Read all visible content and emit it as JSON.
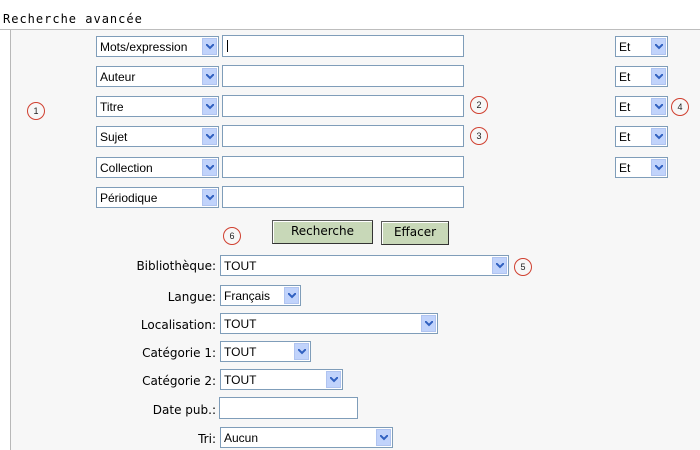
{
  "page": {
    "title": "Recherche avancée"
  },
  "criteria": [
    {
      "field": "Mots/expression",
      "value": "",
      "operator": "Et"
    },
    {
      "field": "Auteur",
      "value": "",
      "operator": "Et"
    },
    {
      "field": "Titre",
      "value": "",
      "operator": "Et"
    },
    {
      "field": "Sujet",
      "value": "",
      "operator": "Et"
    },
    {
      "field": "Collection",
      "value": "",
      "operator": "Et"
    },
    {
      "field": "Périodique",
      "value": ""
    }
  ],
  "buttons": {
    "search": "Recherche",
    "clear": "Effacer"
  },
  "filters": {
    "bibliotheque": {
      "label": "Bibliothèque:",
      "value": "TOUT"
    },
    "langue": {
      "label": "Langue:",
      "value": "Français"
    },
    "localisation": {
      "label": "Localisation:",
      "value": "TOUT"
    },
    "categorie1": {
      "label": "Catégorie 1:",
      "value": "TOUT"
    },
    "categorie2": {
      "label": "Catégorie 2:",
      "value": "TOUT"
    },
    "datepub": {
      "label": "Date pub.:",
      "value": ""
    },
    "tri": {
      "label": "Tri:",
      "value": "Aucun"
    }
  },
  "callouts": [
    "1",
    "2",
    "3",
    "4",
    "5",
    "6"
  ],
  "colors": {
    "dropdown_button": "#c1d3fb",
    "action_button": "#c8d8b8",
    "callout_ring": "#d04030"
  },
  "icons": {
    "dropdown": "chevron-down-icon"
  }
}
